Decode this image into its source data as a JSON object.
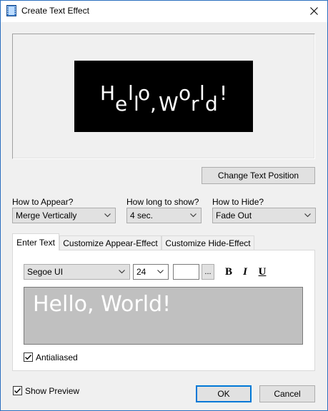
{
  "window": {
    "title": "Create Text Effect"
  },
  "preview": {
    "letters": [
      "H",
      "e",
      "l",
      "l",
      "o",
      ",",
      "W",
      "o",
      "r",
      "l",
      "d",
      "!"
    ]
  },
  "buttons": {
    "change_position": "Change Text Position",
    "ok": "OK",
    "cancel": "Cancel"
  },
  "appear": {
    "label": "How to Appear?",
    "value": "Merge Vertically"
  },
  "duration": {
    "label": "How long to show?",
    "value": "4 sec."
  },
  "hide": {
    "label": "How to Hide?",
    "value": "Fade Out"
  },
  "tabs": [
    {
      "label": "Enter Text",
      "active": true
    },
    {
      "label": "Customize Appear-Effect",
      "active": false
    },
    {
      "label": "Customize Hide-Effect",
      "active": false
    }
  ],
  "font": {
    "family": "Segoe UI",
    "size": "24",
    "browse_label": "...",
    "bold": "B",
    "italic": "I",
    "underline": "U"
  },
  "editor": {
    "text": "Hello, World!",
    "background": "#c0c0c0",
    "text_color": "#ffffff"
  },
  "antialiased": {
    "label": "Antialiased",
    "checked": true
  },
  "show_preview": {
    "label": "Show Preview",
    "checked": true
  },
  "colors": {
    "accent": "#0078d7",
    "preview_bg": "#000000",
    "window_border": "#2b6fbf"
  }
}
